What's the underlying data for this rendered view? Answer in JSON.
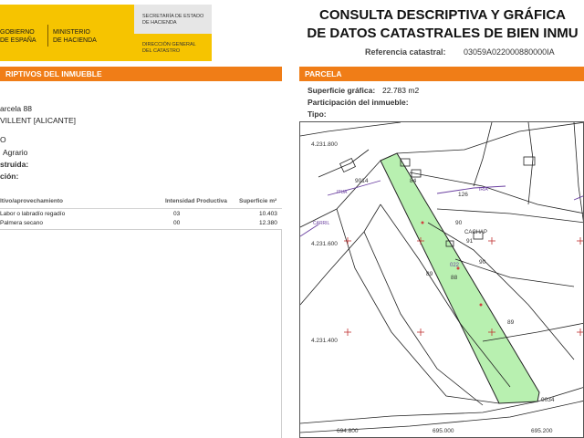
{
  "header": {
    "gov_line1": "GOBIERNO",
    "gov_line2": "DE ESPAÑA",
    "ministry_line1": "MINISTERIO",
    "ministry_line2": "DE HACIENDA",
    "secretaria_line1": "SECRETARÍA DE ESTADO",
    "secretaria_line2": "DE HACIENDA",
    "direccion_line1": "DIRECCIÓN GENERAL",
    "direccion_line2": "DEL CATASTRO",
    "title_line1": "CONSULTA DESCRIPTIVA Y GRÁFICA",
    "title_line2": "DE DATOS CATASTRALES DE BIEN INMU",
    "ref_label": "Referencia catastral:",
    "ref_value": "03059A022000880000IA"
  },
  "left": {
    "section_title": "RIPTIVOS DEL INMUEBLE",
    "parcela_text": "arcela 88",
    "municipio_text": "VILLENT [ALICANTE]",
    "clase_text": "O",
    "uso_text": "Agrario",
    "construida_label": "struida:",
    "construccion_label": "ción:",
    "table_headers": {
      "cultivo": "ltivo/aprovechamiento",
      "intensidad": "Intensidad Productiva",
      "superficie": "Superficie m²"
    },
    "rows": [
      {
        "cultivo": "Labor o labradío regadío",
        "intensidad": "03",
        "superficie": "10.403"
      },
      {
        "cultivo": "Palmera secano",
        "intensidad": "00",
        "superficie": "12.380"
      }
    ]
  },
  "right": {
    "section_title": "PARCELA",
    "superficie_label": "Superficie gráfica:",
    "superficie_value": "22.783 m2",
    "participacion_label": "Participación del inmueble:",
    "tipo_label": "Tipo:"
  },
  "map": {
    "coord_y1": "4.231.800",
    "coord_y2": "4.231.600",
    "coord_y3": "4.231.400",
    "coord_x1": "694.800",
    "coord_x2": "695.000",
    "coord_x3": "695.200",
    "parcel_labels": [
      "9014",
      "84",
      "126",
      "90",
      "91",
      "89",
      "88",
      "90",
      "89",
      "9034"
    ],
    "place_name": "CACHAP",
    "code_label": "022",
    "road_labels": [
      "ITUA",
      "IRIA",
      "CARRIL"
    ],
    "highlight_color": "#b8f0b0",
    "line_color": "#1a1a1a"
  },
  "colors": {
    "accent_orange": "#f07d17",
    "gov_yellow": "#f6c400"
  }
}
